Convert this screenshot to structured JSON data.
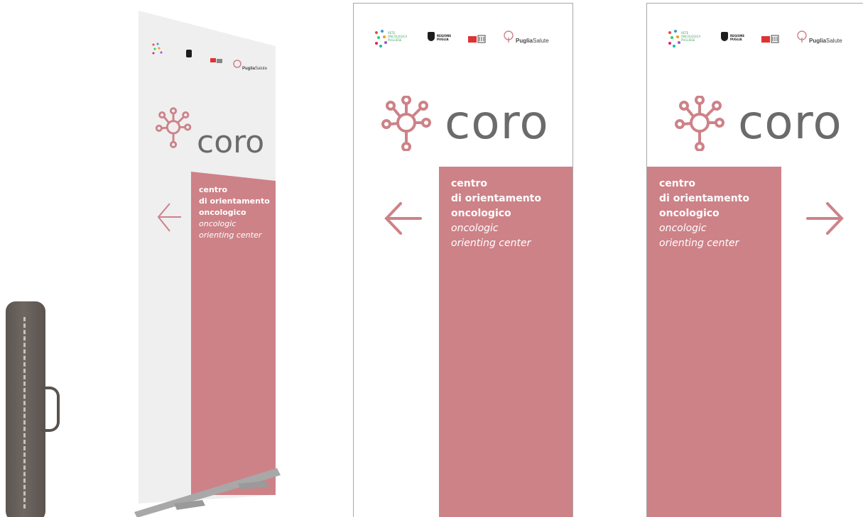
{
  "banner": {
    "logo_rete_text": "RETE\nONCOLOGICA\nPUGLIESE",
    "logo_regione_text": "REGIONE\nPUGLIA",
    "logo_puglia_bold": "Puglia",
    "logo_puglia_light": "Salute",
    "wordmark": "coro",
    "title_lines": [
      "centro",
      "di orientamento",
      "oncologico"
    ],
    "subtitle_lines": [
      "oncologic",
      "orienting center"
    ]
  },
  "colors": {
    "brand_pink": "#cd8288",
    "wordmark_gray": "#6b6b6b",
    "bag": "#5d5550",
    "banner_bg": "#f0f0f0"
  },
  "icons": {
    "coro_mark": "coro-molecule-icon",
    "left_arrow": "arrow-left-icon",
    "right_arrow": "arrow-right-icon"
  }
}
